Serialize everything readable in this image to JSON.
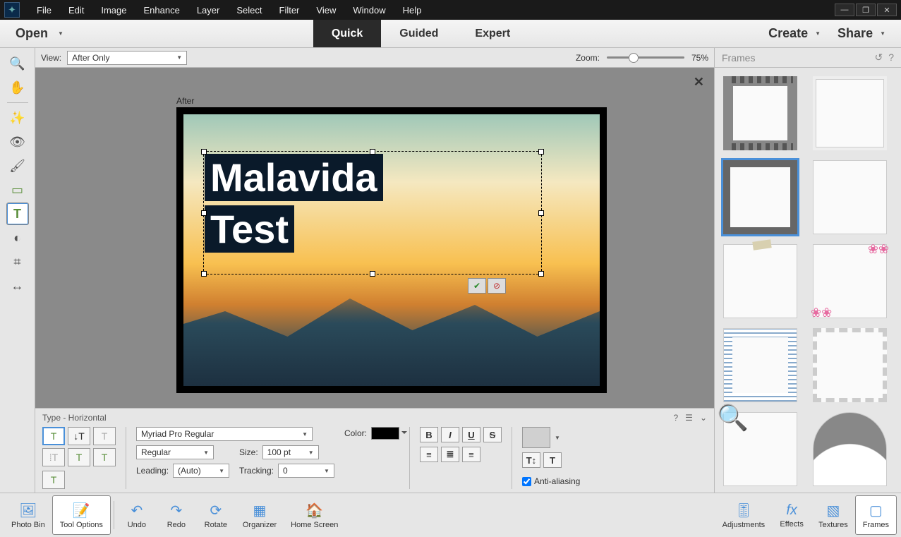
{
  "menu": {
    "items": [
      "File",
      "Edit",
      "Image",
      "Enhance",
      "Layer",
      "Select",
      "Filter",
      "View",
      "Window",
      "Help"
    ]
  },
  "modebar": {
    "open": "Open",
    "tabs": {
      "quick": "Quick",
      "guided": "Guided",
      "expert": "Expert"
    },
    "active": "quick",
    "create": "Create",
    "share": "Share"
  },
  "viewbar": {
    "label": "View:",
    "view_mode": "After Only",
    "zoom_label": "Zoom:",
    "zoom_value": "75%"
  },
  "canvas": {
    "image_label": "After",
    "text_line1": "Malavida",
    "text_line2": "Test"
  },
  "options": {
    "title": "Type - Horizontal",
    "font": "Myriad Pro Regular",
    "style": "Regular",
    "size_label": "Size:",
    "size": "100 pt",
    "color_label": "Color:",
    "leading_label": "Leading:",
    "leading": "(Auto)",
    "tracking_label": "Tracking:",
    "tracking": "0",
    "antialias_label": "Anti-aliasing",
    "antialias_checked": true
  },
  "rightpanel": {
    "title": "Frames"
  },
  "bottombar": {
    "photobin": "Photo Bin",
    "tooloptions": "Tool Options",
    "undo": "Undo",
    "redo": "Redo",
    "rotate": "Rotate",
    "organizer": "Organizer",
    "homescreen": "Home Screen",
    "adjustments": "Adjustments",
    "effects": "Effects",
    "textures": "Textures",
    "frames": "Frames"
  }
}
